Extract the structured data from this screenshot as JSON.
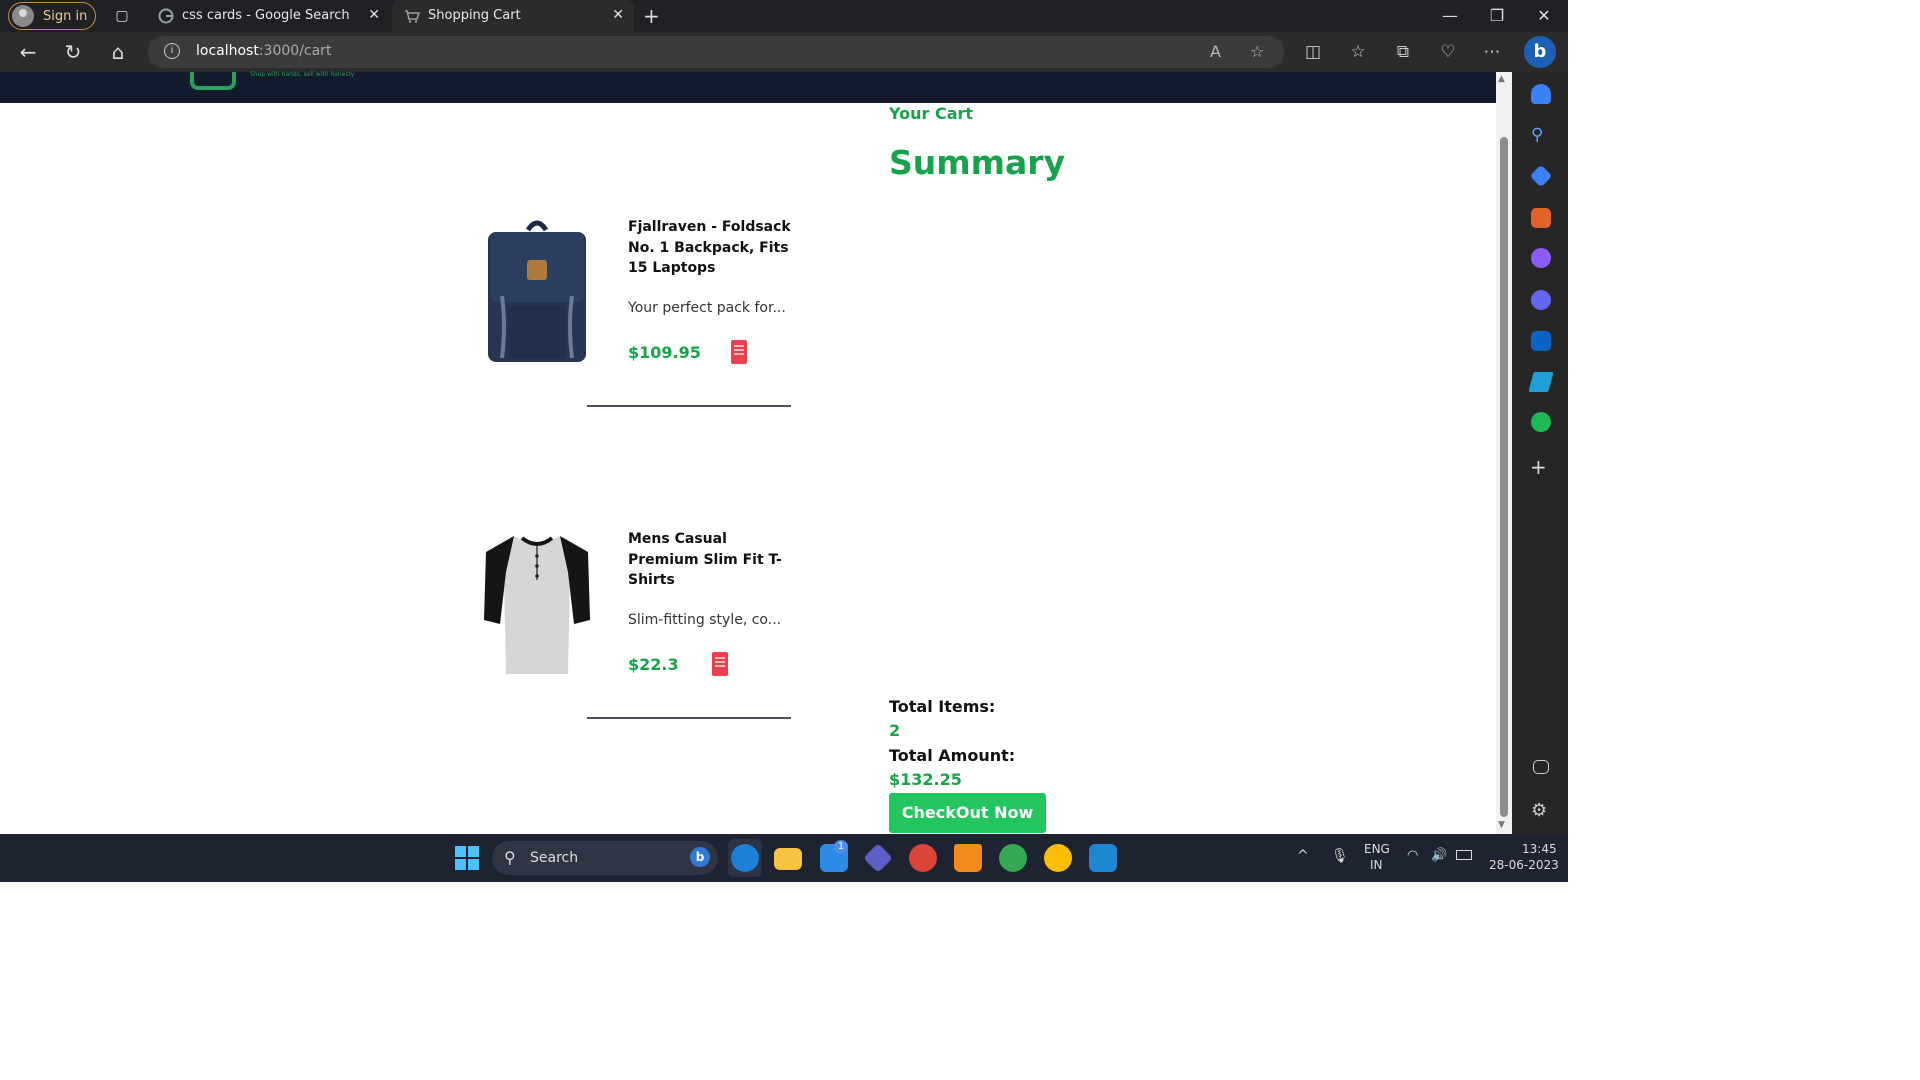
{
  "browser": {
    "signin_label": "Sign in",
    "tabs": [
      {
        "title": "css cards - Google Search"
      },
      {
        "title": "Shopping Cart"
      }
    ],
    "url_host": "localhost",
    "url_path": ":3000/cart"
  },
  "site": {
    "tagline": "Shop with hands, sell with honesty"
  },
  "cart": {
    "heading": "Your Cart",
    "items": [
      {
        "name": "Fjallraven - Foldsack No. 1 Backpack, Fits 15 Laptops",
        "description": "Your perfect pack for...",
        "price": "$109.95"
      },
      {
        "name": "Mens Casual Premium Slim Fit T-Shirts",
        "description": "Slim-fitting style, co...",
        "price": "$22.3"
      }
    ]
  },
  "summary": {
    "title": "Summary",
    "total_items_label": "Total Items:",
    "total_items_value": "2",
    "total_amount_label": "Total Amount:",
    "total_amount_value": "$132.25",
    "checkout_label": "CheckOut Now"
  },
  "taskbar": {
    "search_label": "Search",
    "lang": "ENG",
    "region": "IN",
    "time": "13:45",
    "date": "28-06-2023",
    "mail_badge": "1"
  },
  "colors": {
    "accent_green": "#17a34a",
    "button_green": "#22c55e",
    "delete_red": "#ea3f4c",
    "header_navy": "#121a2d"
  }
}
